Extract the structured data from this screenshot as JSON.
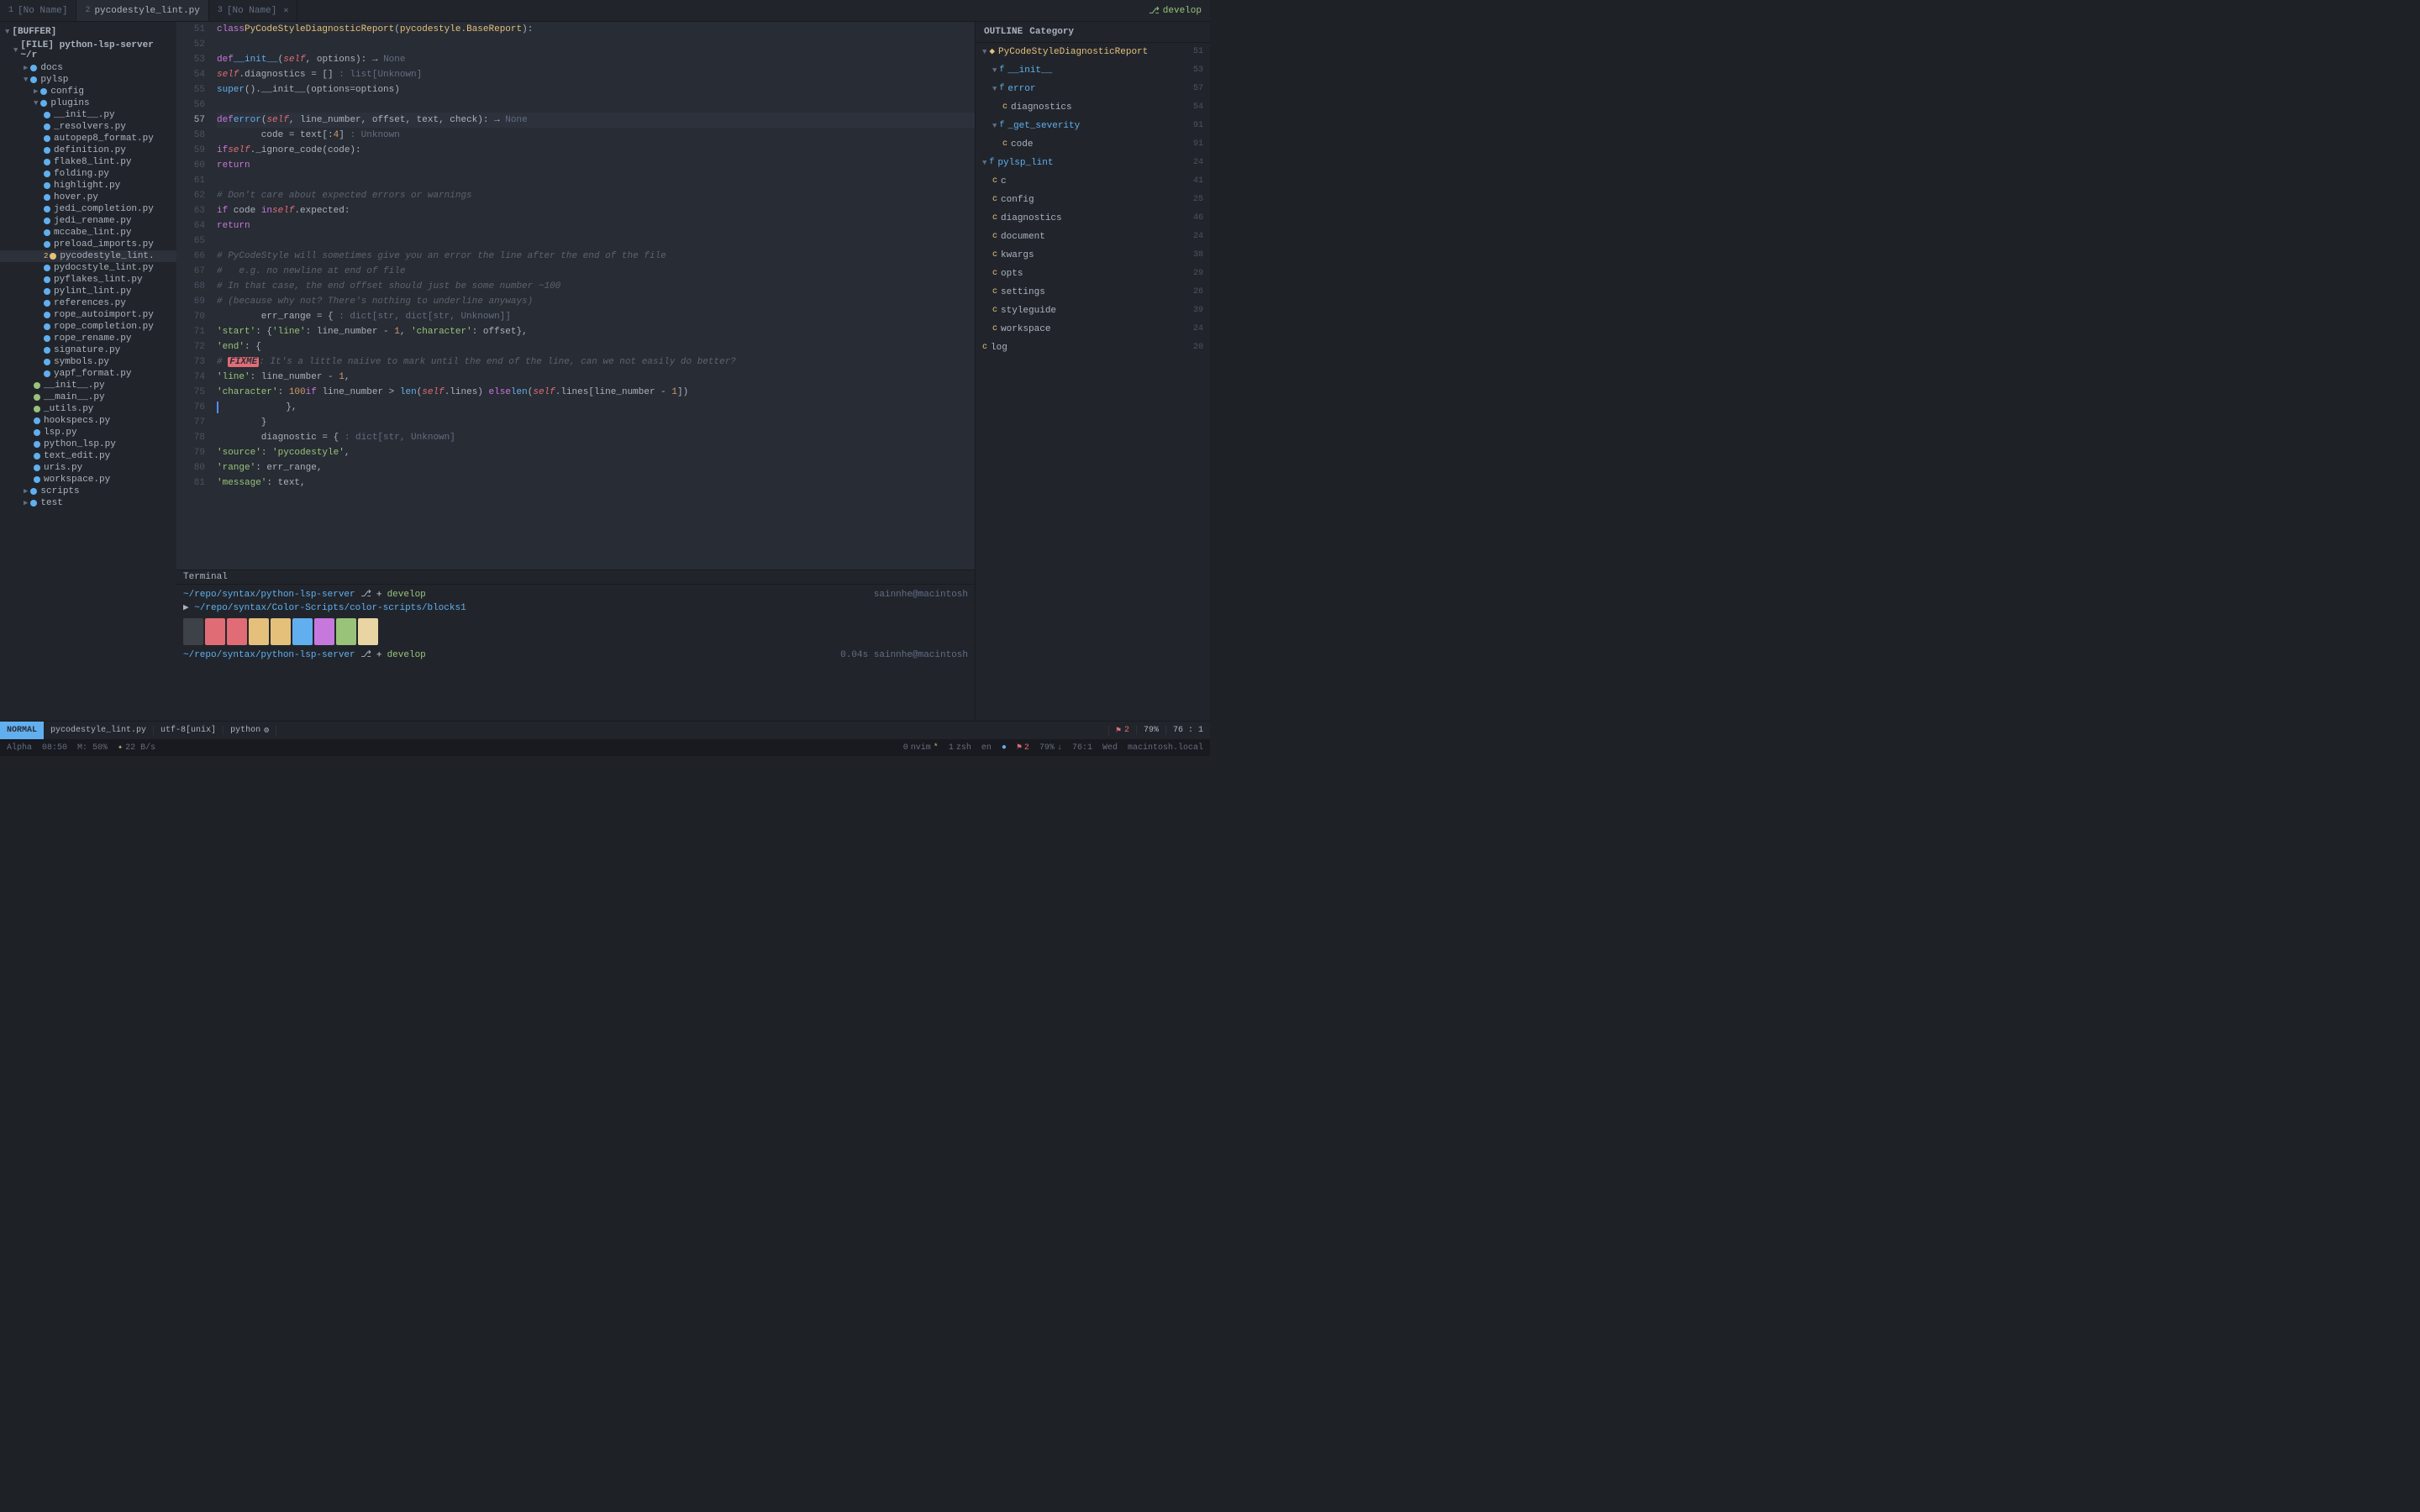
{
  "tabs": [
    {
      "num": "1",
      "label": "[No Name]",
      "active": false,
      "closable": false
    },
    {
      "num": "2",
      "label": "pycodestyle_lint.py",
      "active": true,
      "closable": false
    },
    {
      "num": "3",
      "label": "[No Name]",
      "active": false,
      "closable": true
    }
  ],
  "tab_develop": "develop",
  "sidebar": {
    "buffer_label": "[BUFFER]",
    "file_label": "[FILE] python-lsp-server ~/r",
    "items": [
      {
        "label": "docs",
        "indent": 2,
        "type": "dir",
        "arrow": "▶"
      },
      {
        "label": "pylsp",
        "indent": 2,
        "type": "dir_open",
        "arrow": "▼"
      },
      {
        "label": "config",
        "indent": 3,
        "type": "dir",
        "arrow": "▶"
      },
      {
        "label": "plugins",
        "indent": 3,
        "type": "dir_open",
        "arrow": "▼"
      },
      {
        "label": "__init__.py",
        "indent": 4,
        "type": "file_blue"
      },
      {
        "label": "_resolvers.py",
        "indent": 4,
        "type": "file_blue"
      },
      {
        "label": "autopep8_format.py",
        "indent": 4,
        "type": "file_blue"
      },
      {
        "label": "definition.py",
        "indent": 4,
        "type": "file_blue"
      },
      {
        "label": "flake8_lint.py",
        "indent": 4,
        "type": "file_blue"
      },
      {
        "label": "folding.py",
        "indent": 4,
        "type": "file_blue"
      },
      {
        "label": "highlight.py",
        "indent": 4,
        "type": "file_blue"
      },
      {
        "label": "hover.py",
        "indent": 4,
        "type": "file_blue"
      },
      {
        "label": "jedi_completion.py",
        "indent": 4,
        "type": "file_blue"
      },
      {
        "label": "jedi_rename.py",
        "indent": 4,
        "type": "file_blue"
      },
      {
        "label": "mccabe_lint.py",
        "indent": 4,
        "type": "file_blue"
      },
      {
        "label": "preload_imports.py",
        "indent": 4,
        "type": "file_blue"
      },
      {
        "label": "2 pycodestyle_lint.",
        "indent": 4,
        "type": "file_modified",
        "badge": "2"
      },
      {
        "label": "pydocstyle_lint.py",
        "indent": 4,
        "type": "file_blue"
      },
      {
        "label": "pyflakes_lint.py",
        "indent": 4,
        "type": "file_blue"
      },
      {
        "label": "pylint_lint.py",
        "indent": 4,
        "type": "file_blue"
      },
      {
        "label": "references.py",
        "indent": 4,
        "type": "file_blue"
      },
      {
        "label": "rope_autoimport.py",
        "indent": 4,
        "type": "file_blue"
      },
      {
        "label": "rope_completion.py",
        "indent": 4,
        "type": "file_blue"
      },
      {
        "label": "rope_rename.py",
        "indent": 4,
        "type": "file_blue"
      },
      {
        "label": "signature.py",
        "indent": 4,
        "type": "file_blue"
      },
      {
        "label": "symbols.py",
        "indent": 4,
        "type": "file_blue"
      },
      {
        "label": "yapf_format.py",
        "indent": 4,
        "type": "file_blue"
      },
      {
        "label": "__init__.py",
        "indent": 3,
        "type": "file_green"
      },
      {
        "label": "__main__.py",
        "indent": 3,
        "type": "file_green"
      },
      {
        "label": "_utils.py",
        "indent": 3,
        "type": "file_green"
      },
      {
        "label": "hookspecs.py",
        "indent": 3,
        "type": "file_blue"
      },
      {
        "label": "lsp.py",
        "indent": 3,
        "type": "file_blue"
      },
      {
        "label": "python_lsp.py",
        "indent": 3,
        "type": "file_blue"
      },
      {
        "label": "text_edit.py",
        "indent": 3,
        "type": "file_blue"
      },
      {
        "label": "uris.py",
        "indent": 3,
        "type": "file_blue"
      },
      {
        "label": "workspace.py",
        "indent": 3,
        "type": "file_blue"
      },
      {
        "label": "scripts",
        "indent": 2,
        "type": "dir",
        "arrow": "▶"
      },
      {
        "label": "test",
        "indent": 2,
        "type": "dir",
        "arrow": "▶"
      }
    ]
  },
  "outline": {
    "header": "OUTLINE",
    "category": "Category",
    "items": [
      {
        "label": "PyCodeStyleDiagnosticReport",
        "type": "class",
        "line": "51",
        "indent": 0,
        "arrow": "▼"
      },
      {
        "label": "f __init__",
        "type": "f",
        "line": "53",
        "indent": 1,
        "arrow": "▼"
      },
      {
        "label": "f error",
        "type": "f",
        "line": "57",
        "indent": 1,
        "arrow": "▼"
      },
      {
        "label": "diagnostics",
        "type": "c",
        "line": "54",
        "indent": 2
      },
      {
        "label": "f _get_severity",
        "type": "f",
        "line": "91",
        "indent": 1,
        "arrow": "▼"
      },
      {
        "label": "code",
        "type": "c",
        "line": "91",
        "indent": 2
      },
      {
        "label": "f pylsp_lint",
        "type": "f",
        "line": "24",
        "indent": 0,
        "arrow": "▼"
      },
      {
        "label": "c 41",
        "type": "c",
        "line": "",
        "indent": 1
      },
      {
        "label": "config",
        "type": "c",
        "line": "25",
        "indent": 1
      },
      {
        "label": "diagnostics",
        "type": "c",
        "line": "46",
        "indent": 1
      },
      {
        "label": "document",
        "type": "c",
        "line": "24",
        "indent": 1
      },
      {
        "label": "kwargs",
        "type": "c",
        "line": "38",
        "indent": 1
      },
      {
        "label": "opts",
        "type": "c",
        "line": "29",
        "indent": 1
      },
      {
        "label": "settings",
        "type": "c",
        "line": "26",
        "indent": 1
      },
      {
        "label": "styleguide",
        "type": "c",
        "line": "39",
        "indent": 1
      },
      {
        "label": "workspace",
        "type": "c",
        "line": "24",
        "indent": 1
      },
      {
        "label": "log 20",
        "type": "c",
        "line": "",
        "indent": 0
      }
    ]
  },
  "code_lines": [
    {
      "num": "51",
      "content_html": "<span class='kw'>class</span> <span class='cls'>PyCodeStyleDiagnosticReport</span>(<span class='cls'>pycodestyle</span>.<span class='cls'>BaseReport</span>):"
    },
    {
      "num": "52",
      "content_html": ""
    },
    {
      "num": "53",
      "content_html": "    <span class='kw'>def</span> <span class='fn'>__init__</span>(<span class='self-kw'>self</span>, options): → <span class='type-hint'>None</span>"
    },
    {
      "num": "54",
      "content_html": "        <span class='self-kw'>self</span>.diagnostics = [] <span class='type-hint'>: list[Unknown]</span>"
    },
    {
      "num": "55",
      "content_html": "        <span class='fn'>super</span>().__init__(options=options)"
    },
    {
      "num": "56",
      "content_html": ""
    },
    {
      "num": "57",
      "content_html": "    <span class='kw'>def</span> <span class='fn'>error</span>(<span class='self-kw'>self</span>, line_number, offset, text, check): → <span class='type-hint'>None</span>",
      "active": true
    },
    {
      "num": "58",
      "content_html": "        code = text[:<span class='num'>4</span>] <span class='type-hint'>: Unknown</span>"
    },
    {
      "num": "59",
      "content_html": "        <span class='kw'>if</span> <span class='self-kw'>self</span>._ignore_code(code):"
    },
    {
      "num": "60",
      "content_html": "            <span class='kw'>return</span>"
    },
    {
      "num": "61",
      "content_html": ""
    },
    {
      "num": "62",
      "content_html": "        <span class='cm'># Don't care about expected errors or warnings</span>"
    },
    {
      "num": "63",
      "content_html": "        <span class='kw'>if</span> code <span class='kw'>in</span> <span class='self-kw'>self</span>.expected:"
    },
    {
      "num": "64",
      "content_html": "            <span class='kw'>return</span>"
    },
    {
      "num": "65",
      "content_html": ""
    },
    {
      "num": "66",
      "content_html": "        <span class='cm'># PyCodeStyle will sometimes give you an error the line after the end of the file</span>"
    },
    {
      "num": "67",
      "content_html": "        <span class='cm'>#   e.g. no newline at end of file</span>"
    },
    {
      "num": "68",
      "content_html": "        <span class='cm'># In that case, the end offset should just be some number ~100</span>"
    },
    {
      "num": "69",
      "content_html": "        <span class='cm'># (because why not? There's nothing to underline anyways)</span>"
    },
    {
      "num": "70",
      "content_html": "        err_range = { <span class='type-hint'>: dict[str, dict[str, Unknown]]</span>"
    },
    {
      "num": "71",
      "content_html": "            <span class='str'>'start'</span>: {<span class='str'>'line'</span>: line_number - <span class='num'>1</span>, <span class='str'>'character'</span>: offset},"
    },
    {
      "num": "72",
      "content_html": "            <span class='str'>'end'</span>: {"
    },
    {
      "num": "73",
      "content_html": "                <span class='cm'># <span class='fixme-badge'>FIXME</span>: It's a little naiive to mark until the end of the line, can we not easily do better?</span>"
    },
    {
      "num": "74",
      "content_html": "                <span class='str'>'line'</span>: line_number - <span class='num'>1</span>,"
    },
    {
      "num": "75",
      "content_html": "                <span class='str'>'character'</span>: <span class='num'>100</span> <span class='kw'>if</span> line_number > <span class='fn'>len</span>(<span class='self-kw'>self</span>.lines) <span class='kw'>else</span> <span class='fn'>len</span>(<span class='self-kw'>self</span>.lines[line_number - <span class='num'>1</span>])"
    },
    {
      "num": "76",
      "content_html": "            },",
      "cursor": true
    },
    {
      "num": "77",
      "content_html": "        }"
    },
    {
      "num": "78",
      "content_html": "        diagnostic = { <span class='type-hint'>: dict[str, Unknown]</span>"
    },
    {
      "num": "79",
      "content_html": "            <span class='str'>'source'</span>: <span class='str'>'pycodestyle'</span>,"
    },
    {
      "num": "80",
      "content_html": "            <span class='str'>'range'</span>: err_range,"
    },
    {
      "num": "81",
      "content_html": "            <span class='str'>'message'</span>: text,"
    }
  ],
  "terminal": {
    "path1": "~/repo/syntax/python-lsp-server",
    "branch1": "develop",
    "path2": "~/repo/syntax/Color-Scripts/color-scripts/blocks1",
    "path3": "~/repo/syntax/python-lsp-server",
    "branch3": "develop",
    "timing": "0.04s",
    "user": "sainnhe@macintosh",
    "user2": "sainnhe@macintosh"
  },
  "color_blocks": [
    "#3d4148",
    "#e06c75",
    "#e06c75",
    "#e5c07b",
    "#e5c07b",
    "#61afef",
    "#c678dd",
    "#98c379",
    "#e8d5a3"
  ],
  "status_bar": {
    "mode": "NORMAL",
    "file": "pycodestyle_lint.py",
    "encoding": "utf-8[unix]",
    "language": "python",
    "flag": "⚑",
    "errors": "2",
    "percent": "79%",
    "position": "76 : 1"
  },
  "bottom_bar": {
    "alpha": "Alpha",
    "time": "08:50",
    "memory": "M: 50%",
    "network": "✦ 22 B/s",
    "nvim_num": "0",
    "nvim_label": "nvim",
    "star": "*",
    "zsh_num": "1",
    "zsh_label": "zsh",
    "locale": "en",
    "dot": "●",
    "errors": "2",
    "percent": "79%",
    "arrow": "↓",
    "line_col": "76:1",
    "hostname": "macintosh.local",
    "day": "Wed"
  }
}
